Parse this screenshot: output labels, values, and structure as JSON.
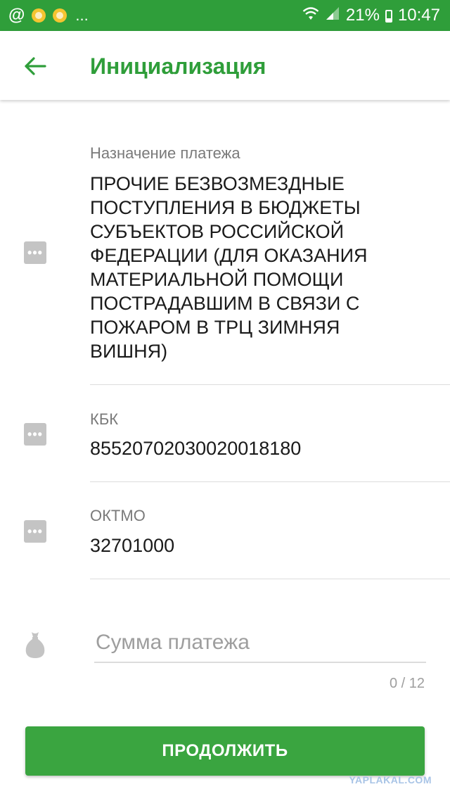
{
  "status_bar": {
    "at_symbol": "@",
    "more": "...",
    "battery": "21%",
    "time": "10:47"
  },
  "header": {
    "title": "Инициализация"
  },
  "fields": {
    "purpose": {
      "label": "Назначение платежа",
      "value": "ПРОЧИЕ БЕЗВОЗМЕЗДНЫЕ ПОСТУПЛЕНИЯ В БЮДЖЕТЫ СУБЪЕКТОВ РОССИЙСКОЙ ФЕДЕРАЦИИ (ДЛЯ ОКАЗАНИЯ МАТЕРИАЛЬНОЙ ПОМОЩИ ПОСТРАДАВШИМ В СВЯЗИ С ПОЖАРОМ В ТРЦ ЗИМНЯЯ ВИШНЯ)",
      "icon": "more-icon"
    },
    "kbk": {
      "label": "КБК",
      "value": "85520702030020018180",
      "icon": "more-icon"
    },
    "oktmo": {
      "label": "ОКТМО",
      "value": "32701000",
      "icon": "more-icon"
    }
  },
  "amount": {
    "placeholder": "Сумма платежа",
    "counter": "0 / 12",
    "icon": "money-bag-icon"
  },
  "actions": {
    "continue_label": "ПРОДОЛЖИТЬ"
  },
  "watermark": "YAPLAKAL.COM",
  "colors": {
    "brand_green": "#2f9e3a",
    "button_green": "#3aa540",
    "label_gray": "#7a7a7a",
    "icon_gray": "#c4c4c4"
  }
}
